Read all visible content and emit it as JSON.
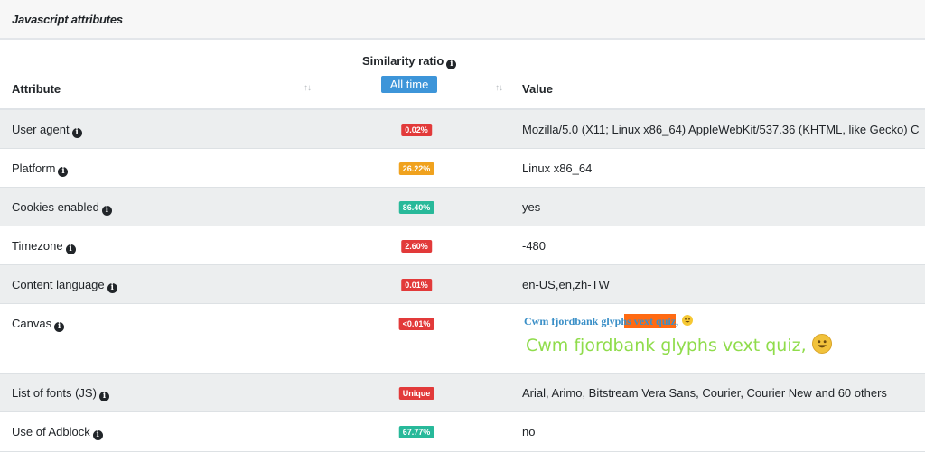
{
  "panel": {
    "title": "Javascript attributes"
  },
  "table": {
    "headers": {
      "attribute": "Attribute",
      "similarity": "Similarity ratio",
      "similarity_filter": "All time",
      "value": "Value",
      "sort_glyph": "↑↓"
    },
    "info_glyph": "i",
    "rows": [
      {
        "attribute": "User agent",
        "ratio": "0.02%",
        "ratio_color": "#e23a3a",
        "value": "Mozilla/5.0 (X11; Linux x86_64) AppleWebKit/537.36 (KHTML, like Gecko) C"
      },
      {
        "attribute": "Platform",
        "ratio": "26.22%",
        "ratio_color": "#f0a21e",
        "value": "Linux x86_64"
      },
      {
        "attribute": "Cookies enabled",
        "ratio": "86.40%",
        "ratio_color": "#28b99a",
        "value": "yes"
      },
      {
        "attribute": "Timezone",
        "ratio": "2.60%",
        "ratio_color": "#e23a3a",
        "value": "-480"
      },
      {
        "attribute": "Content language",
        "ratio": "0.01%",
        "ratio_color": "#e23a3a",
        "value": "en-US,en,zh-TW"
      },
      {
        "attribute": "Canvas",
        "ratio": "<0.01%",
        "ratio_color": "#e23a3a",
        "value_small": "Cwm fjordbank glyphs vext quiz,",
        "value_big": "Cwm fjordbank glyphs vext quiz,"
      },
      {
        "attribute": "List of fonts (JS)",
        "ratio": "Unique",
        "ratio_color": "#e23a3a",
        "value": "Arial, Arimo, Bitstream Vera Sans, Courier, Courier New and 60 others"
      },
      {
        "attribute": "Use of Adblock",
        "ratio": "67.77%",
        "ratio_color": "#28b99a",
        "value": "no"
      }
    ]
  }
}
